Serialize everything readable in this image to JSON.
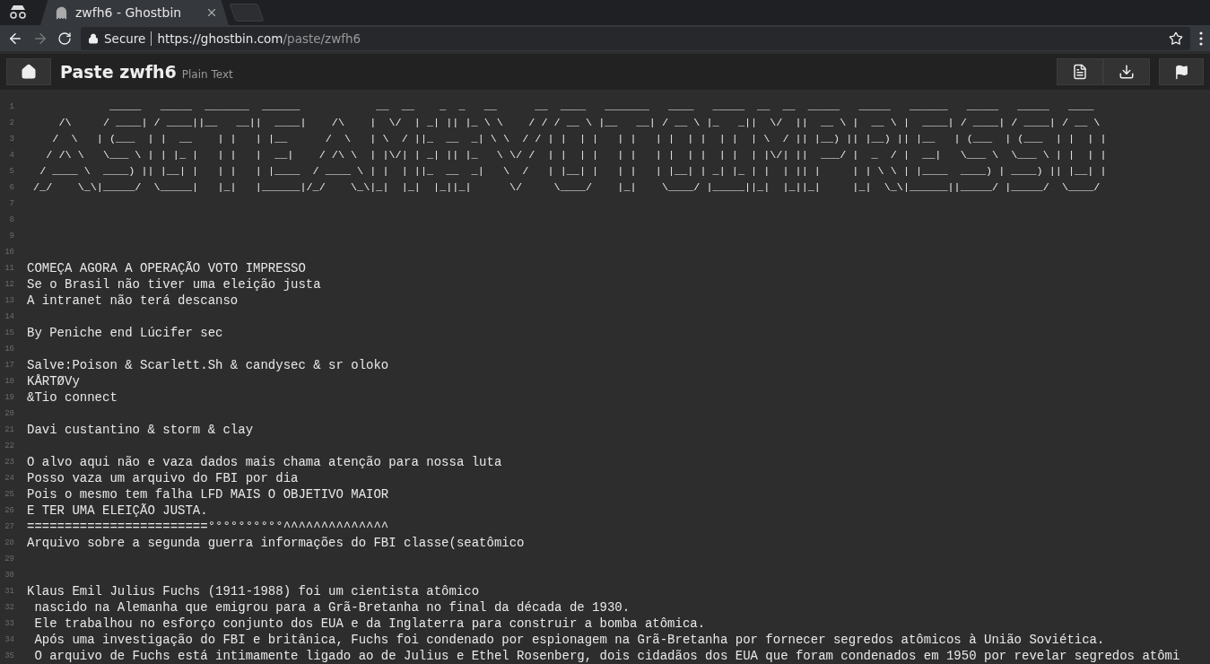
{
  "browser": {
    "tab_title": "zwfh6 - Ghostbin",
    "secure_label": "Secure",
    "url_host": "https://ghostbin.com",
    "url_path": "/paste/zwfh6"
  },
  "header": {
    "title": "Paste zwfh6",
    "language": "Plain Text"
  },
  "lines": [
    {
      "number": "1",
      "kind": "art",
      "text": "             _____   _____  _______  ______            __  __    _  _   __      __  ____   _______   ____   _____  __  __  _____   _____   ______   _____   _____   ____  "
    },
    {
      "number": "2",
      "kind": "art",
      "text": "     /\\     / ____| / ____||__   __||  ____|    /\\    |  \\/  | _| || |_ \\ \\    / / / __ \\ |__   __| / __ \\ |_   _||  \\/  ||  __ \\ |  __ \\ |  ____| / ____| / ____| / __ \\ "
    },
    {
      "number": "3",
      "kind": "art",
      "text": "    /  \\   | (___  | |  __    | |   | |__      /  \\   | \\  / ||_  __  _| \\ \\  / / | |  | |   | |   | |  | |  | |  | \\  / || |__) || |__) || |__   | (___  | (___  | |  | |"
    },
    {
      "number": "4",
      "kind": "art",
      "text": "   / /\\ \\   \\___ \\ | | |_ |   | |   |  __|    / /\\ \\  | |\\/| | _| || |_   \\ \\/ /  | |  | |   | |   | |  | |  | |  | |\\/| ||  ___/ |  _  / |  __|   \\___ \\  \\___ \\ | |  | |"
    },
    {
      "number": "5",
      "kind": "art",
      "text": "  / ____ \\  ____) || |__| |   | |   | |____  / ____ \\ | |  | ||_  __  _|   \\  /   | |__| |   | |   | |__| | _| |_ | |  | || |     | | \\ \\ | |____  ____) | ____) || |__| |"
    },
    {
      "number": "6",
      "kind": "art",
      "text": " /_/    \\_\\|_____/  \\_____|   |_|   |______|/_/    \\_\\|_|  |_|  |_||_|      \\/     \\____/    |_|    \\____/ |_____||_|  |_||_|     |_|  \\_\\|______||_____/ |_____/  \\____/ "
    },
    {
      "number": "7"
    },
    {
      "number": "8"
    },
    {
      "number": "9"
    },
    {
      "number": "10"
    },
    {
      "number": "11",
      "kind": "text",
      "text": "COMEÇA AGORA A OPERAÇÃO VOTO IMPRESSO"
    },
    {
      "number": "12",
      "kind": "text",
      "text": "Se o Brasil não tiver uma eleição justa"
    },
    {
      "number": "13",
      "kind": "text",
      "text": "A intranet não terá descanso"
    },
    {
      "number": "14"
    },
    {
      "number": "15",
      "kind": "text",
      "text": "By Peniche end Lúcifer sec"
    },
    {
      "number": "16"
    },
    {
      "number": "17",
      "kind": "text",
      "text": "Salve:Poison & Scarlett.Sh & candysec & sr oloko"
    },
    {
      "number": "18",
      "kind": "text",
      "text": "KÅRTØVy"
    },
    {
      "number": "19",
      "kind": "text",
      "text": "&Tio connect"
    },
    {
      "number": "20"
    },
    {
      "number": "21",
      "kind": "text",
      "text": "Davi custantino & storm & clay"
    },
    {
      "number": "22"
    },
    {
      "number": "23",
      "kind": "text",
      "text": "O alvo aqui não e vaza dados mais chama atenção para nossa luta"
    },
    {
      "number": "24",
      "kind": "text",
      "text": "Posso vaza um arquivo do FBI por dia"
    },
    {
      "number": "25",
      "kind": "text",
      "text": "Pois o mesmo tem falha LFD MAIS O OBJETIVO MAIOR"
    },
    {
      "number": "26",
      "kind": "text",
      "text": "E TER UMA ELEIÇÃO JUSTA."
    },
    {
      "number": "27",
      "kind": "text",
      "text": "========================°°°°°°°°°°^^^^^^^^^^^^^^"
    },
    {
      "number": "28",
      "kind": "text",
      "text": "Arquivo sobre a segunda guerra informações do FBI classe(seatômico"
    },
    {
      "number": "29"
    },
    {
      "number": "30"
    },
    {
      "number": "31",
      "kind": "text",
      "text": "Klaus Emil Julius Fuchs (1911-1988) foi um cientista atômico"
    },
    {
      "number": "32",
      "kind": "text",
      "text": " nascido na Alemanha que emigrou para a Grã-Bretanha no final da década de 1930."
    },
    {
      "number": "33",
      "kind": "text",
      "text": " Ele trabalhou no esforço conjunto dos EUA e da Inglaterra para construir a bomba atômica."
    },
    {
      "number": "34",
      "kind": "text",
      "text": " Após uma investigação do FBI e britânica, Fuchs foi condenado por espionagem na Grã-Bretanha por fornecer segredos atômicos à União Soviética."
    },
    {
      "number": "35",
      "kind": "text",
      "text": " O arquivo de Fuchs está intimamente ligado ao de Julius e Ethel Rosenberg, dois cidadãos dos EUA que foram condenados em 1950 por revelar segredos atômi"
    }
  ]
}
